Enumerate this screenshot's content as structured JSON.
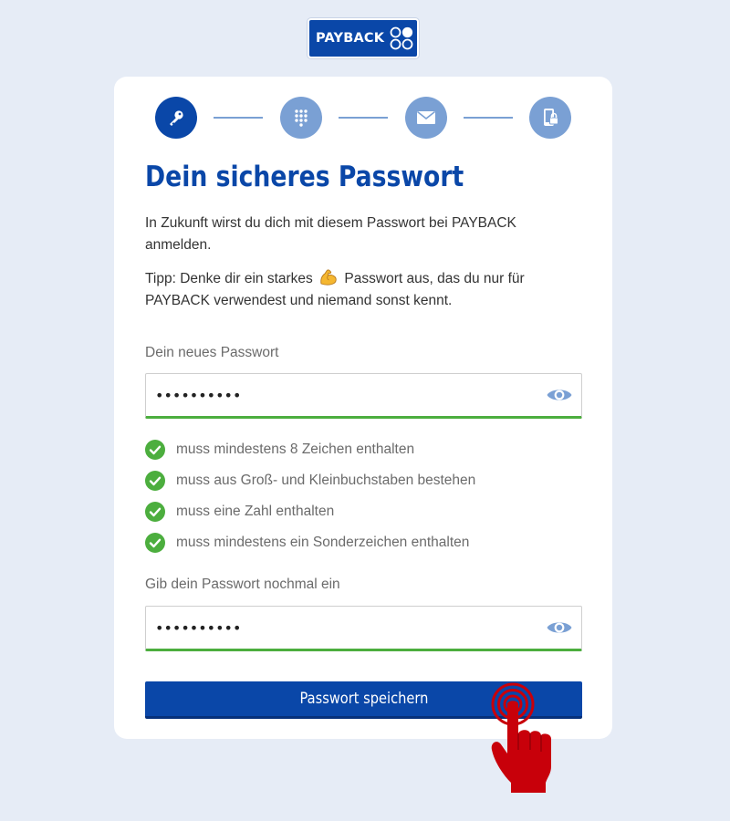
{
  "logo": {
    "text": "PAYBACK",
    "brand_color": "#0a47a8"
  },
  "stepper": {
    "steps": [
      {
        "icon": "key-icon",
        "active": true
      },
      {
        "icon": "keypad-icon",
        "active": false
      },
      {
        "icon": "envelope-icon",
        "active": false
      },
      {
        "icon": "phone-lock-icon",
        "active": false
      }
    ],
    "active_color": "#0a47a8",
    "inactive_color": "#7aa0d4"
  },
  "page": {
    "title": "Dein sicheres Passwort",
    "intro": "In Zukunft wirst du dich mit diesem Passwort bei PAYBACK anmelden.",
    "tip_before": "Tipp: Denke dir ein starkes",
    "tip_emoji": "flexed-biceps-icon",
    "tip_after": "Passwort aus, das du nur für PAYBACK verwendest und niemand sonst kennt."
  },
  "password": {
    "label": "Dein neues Passwort",
    "value": "••••••••••"
  },
  "rules": [
    {
      "text": "muss mindestens 8 Zeichen enthalten",
      "met": true
    },
    {
      "text": "muss aus Groß- und Kleinbuchstaben bestehen",
      "met": true
    },
    {
      "text": "muss eine Zahl enthalten",
      "met": true
    },
    {
      "text": "muss mindestens ein Sonderzeichen enthalten",
      "met": true
    }
  ],
  "confirm": {
    "label": "Gib dein Passwort nochmal ein",
    "value": "••••••••••"
  },
  "submit": {
    "label": "Passwort speichern"
  },
  "colors": {
    "success": "#4cae3e",
    "pointer": "#c8000a"
  }
}
